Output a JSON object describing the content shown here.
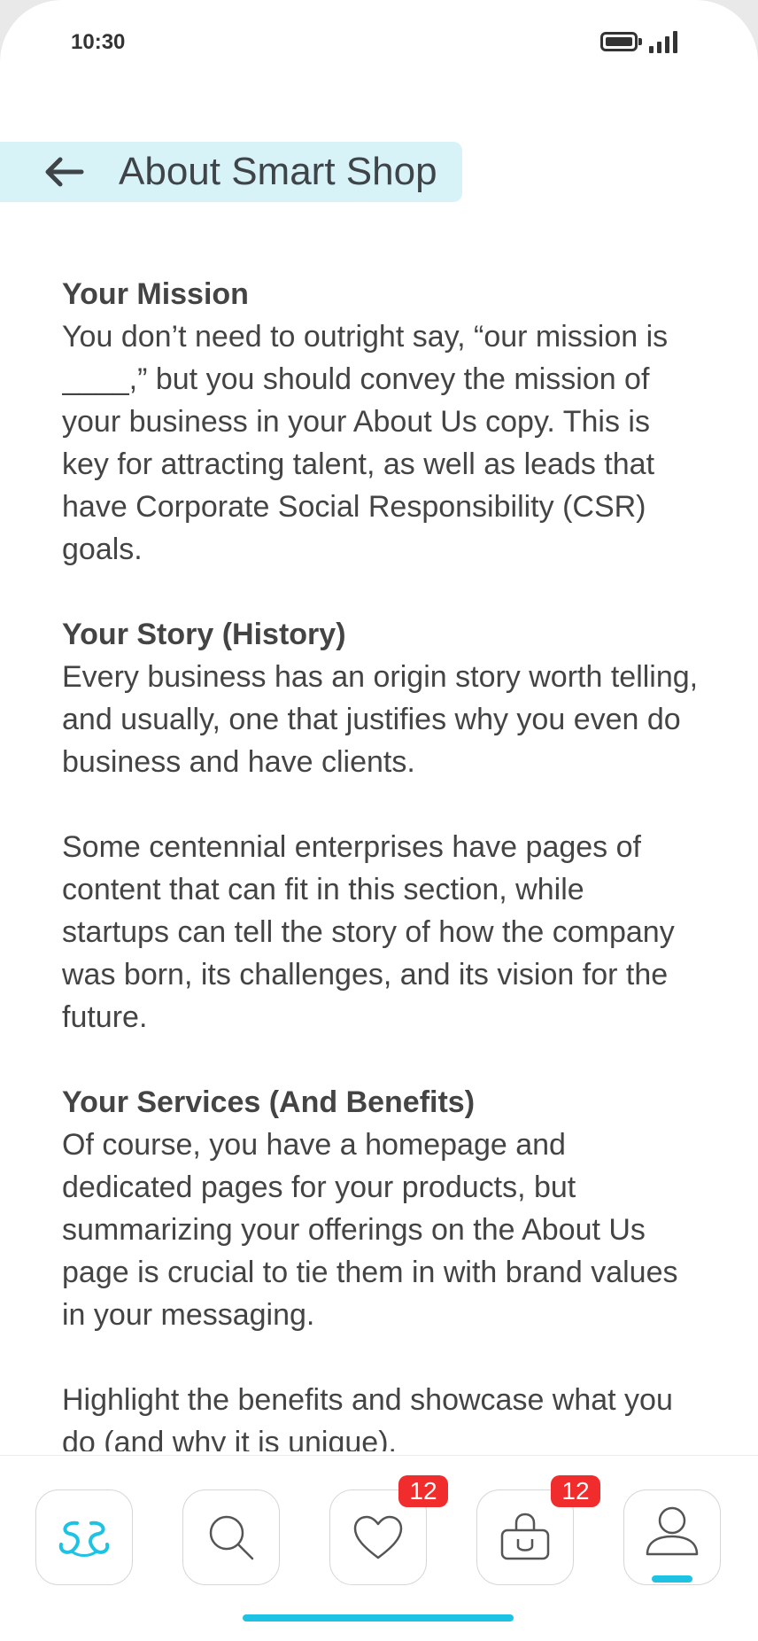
{
  "status_bar": {
    "time": "10:30"
  },
  "header": {
    "title": "About Smart Shop"
  },
  "sections": [
    {
      "title": "Your Mission",
      "paragraphs": [
        "You don’t need to outright say, “our mission is ____,” but you should convey the mission of your business in your About Us copy. This is key for attracting talent, as well as leads that have Corporate Social Responsibility (CSR) goals."
      ]
    },
    {
      "title": "Your Story (History)",
      "paragraphs": [
        "Every business has an origin story worth telling, and usually, one that justifies why you even do business and have clients.",
        "Some centennial enterprises have pages of content that can fit in this section, while startups can tell the story of how the company was born, its challenges, and its vision for the future."
      ]
    },
    {
      "title": "Your Services (And Benefits)",
      "paragraphs": [
        "Of course, you have a homepage and dedicated pages for your products, but summarizing your offerings on the About Us page is crucial to tie them in with brand values in your messaging.",
        "Highlight the benefits and showcase what you do (and why it is unique)."
      ]
    }
  ],
  "nav": {
    "items": [
      {
        "name": "home",
        "icon": "logo-icon",
        "active": false
      },
      {
        "name": "search",
        "icon": "search-icon",
        "active": false
      },
      {
        "name": "favorites",
        "icon": "heart-icon",
        "badge": "12",
        "active": false
      },
      {
        "name": "cart",
        "icon": "shopping-bag-icon",
        "badge": "12",
        "active": false
      },
      {
        "name": "profile",
        "icon": "user-icon",
        "active": true
      }
    ]
  },
  "colors": {
    "accent": "#1ec3e4",
    "header_bg": "#d7f3f8",
    "badge": "#f12c2c",
    "text": "#444444"
  }
}
